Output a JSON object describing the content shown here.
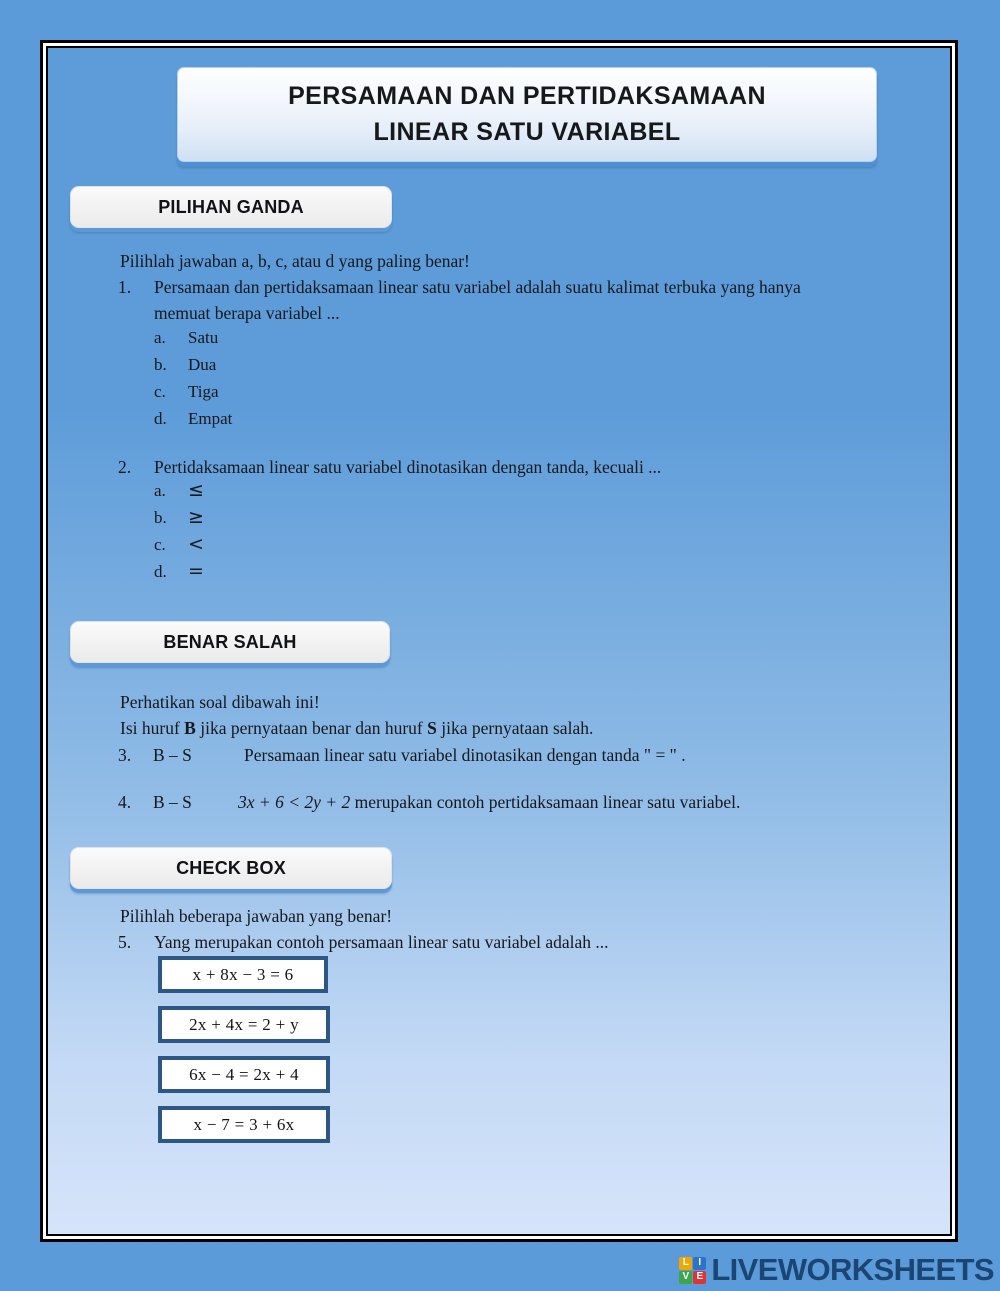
{
  "theme": {
    "page_background": "#5c9bd9",
    "frame_border": "#000000",
    "pill_shadow": "#5b9ad6",
    "answer_box_border": "#2d5785",
    "logo_text_color": "#1b4674"
  },
  "title": {
    "line1": "PERSAMAAN DAN PERTIDAKSAMAAN",
    "line2": "LINEAR SATU VARIABEL"
  },
  "sections": {
    "multiple_choice": {
      "heading": "PILIHAN GANDA",
      "instruction": "Pilihlah jawaban a, b, c, atau d yang paling benar!",
      "questions": [
        {
          "number": "1.",
          "text_line1": "Persamaan dan pertidaksamaan linear satu variabel adalah suatu kalimat terbuka yang hanya",
          "text_line2": "memuat berapa variabel ...",
          "options": [
            {
              "letter": "a.",
              "text": "Satu"
            },
            {
              "letter": "b.",
              "text": "Dua"
            },
            {
              "letter": "c.",
              "text": "Tiga"
            },
            {
              "letter": "d.",
              "text": "Empat"
            }
          ]
        },
        {
          "number": "2.",
          "text_line1": "Pertidaksamaan linear satu variabel dinotasikan dengan tanda, kecuali ...",
          "options": [
            {
              "letter": "a.",
              "text": "≤"
            },
            {
              "letter": "b.",
              "text": "≥"
            },
            {
              "letter": "c.",
              "text": "<"
            },
            {
              "letter": "d.",
              "text": "="
            }
          ]
        }
      ]
    },
    "true_false": {
      "heading": "BENAR SALAH",
      "instruction1": "Perhatikan soal dibawah ini!",
      "instruction2_part1": "Isi huruf ",
      "instruction2_bold1": "B",
      "instruction2_part2": " jika pernyataan benar dan huruf ",
      "instruction2_bold2": "S",
      "instruction2_part3": " jika pernyataan salah.",
      "questions": [
        {
          "number": "3.",
          "answer_slot": "B – S",
          "statement": "Persamaan linear satu variabel dinotasikan dengan tanda \" = \" ."
        },
        {
          "number": "4.",
          "answer_slot": "B – S",
          "statement_math": "3x + 6 < 2y + 2",
          "statement_rest": " merupakan contoh pertidaksamaan linear satu variabel."
        }
      ]
    },
    "check_box": {
      "heading": "CHECK BOX",
      "instruction": "Pilihlah beberapa jawaban yang benar!",
      "question_number": "5.",
      "question_text": "Yang merupakan contoh persamaan linear satu variabel adalah ...",
      "choices": [
        {
          "equation": "x + 8x − 3 = 6"
        },
        {
          "equation": "2x + 4x = 2 + y"
        },
        {
          "equation": "6x − 4 = 2x + 4"
        },
        {
          "equation": "x − 7 = 3 + 6x"
        }
      ]
    }
  },
  "footer": {
    "logo_cells": [
      {
        "letter": "L",
        "color": "#f0a800"
      },
      {
        "letter": "I",
        "color": "#2b74c8"
      },
      {
        "letter": "V",
        "color": "#3aa84a"
      },
      {
        "letter": "E",
        "color": "#e03434"
      }
    ],
    "brand": "LIVEWORKSHEETS"
  }
}
